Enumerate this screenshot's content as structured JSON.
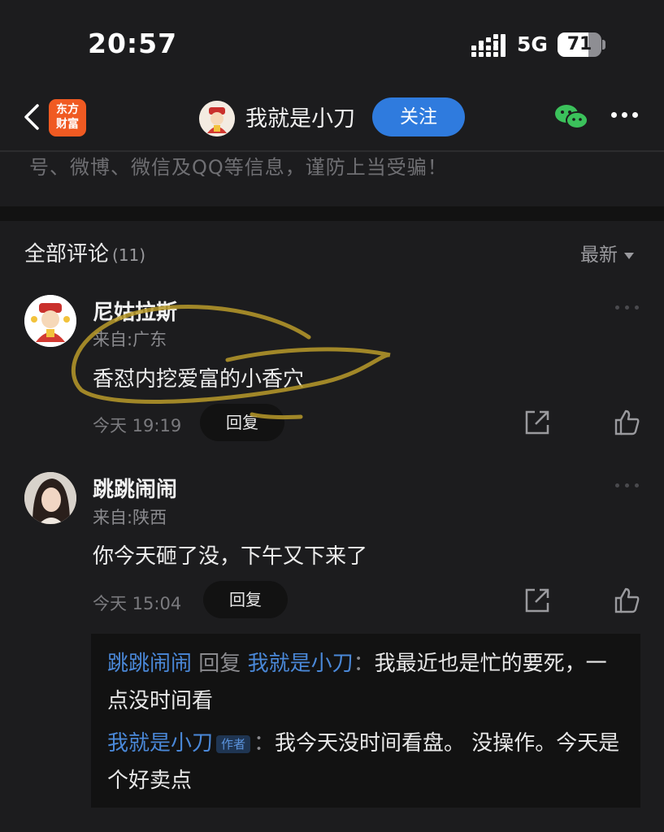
{
  "status_bar": {
    "time": "20:57",
    "network": "5G",
    "battery": "71",
    "battery_level": 0.71
  },
  "nav": {
    "logo_text_line1": "东方",
    "logo_text_line2": "财富",
    "user_name": "我就是小刀",
    "follow_label": "关注",
    "icons": [
      "back-icon",
      "wechat-icon",
      "more-icon"
    ]
  },
  "notice": {
    "text": "号、微博、微信及QQ等信息，谨防上当受骗！"
  },
  "comments_header": {
    "title": "全部评论",
    "count": "(11)",
    "sort_label": "最新"
  },
  "comments": [
    {
      "username": "尼姑拉斯",
      "location": "来自:广东",
      "content": "香怼内挖爱富的小香穴",
      "time": "今天 19:19",
      "reply_label": "回复"
    },
    {
      "username": "跳跳闹闹",
      "location": "来自:陕西",
      "content": "你今天砸了没，下午又下来了",
      "time": "今天 15:04",
      "reply_label": "回复"
    }
  ],
  "replies": [
    {
      "from": "跳跳闹闹",
      "reply_word": "回复",
      "to": "我就是小刀",
      "colon": "：",
      "text": "我最近也是忙的要死，一点没时间看"
    },
    {
      "from": "我就是小刀",
      "author_tag": "作者",
      "colon": "：",
      "text": "我今天没时间看盘。 没操作。今天是个好卖点"
    }
  ],
  "colors": {
    "background": "#1c1c1e",
    "accent_blue": "#2f7bde",
    "link_blue": "#4a88d8",
    "logo_orange": "#f05a22",
    "annotation_yellow": "#b89a2a"
  }
}
